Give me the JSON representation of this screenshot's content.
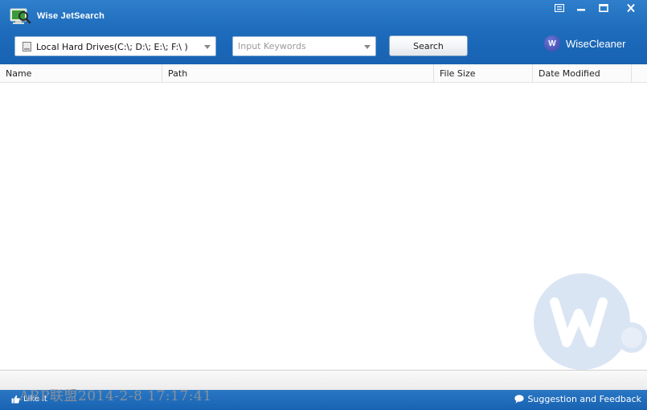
{
  "window": {
    "title": "Wise JetSearch",
    "controls": [
      "menu-icon",
      "minimize-icon",
      "maximize-icon",
      "close-icon"
    ]
  },
  "toolbar": {
    "drive_select": {
      "value": "Local Hard Drives(C:\\; D:\\; E:\\; F:\\ )",
      "icon": "hard-drive-icon"
    },
    "keyword_input": {
      "value": "",
      "placeholder": "Input Keywords"
    },
    "search_label": "Search",
    "brand": {
      "badge": "W",
      "text": "WiseCleaner"
    }
  },
  "results_table": {
    "columns": [
      "Name",
      "Path",
      "File Size",
      "Date Modified"
    ],
    "rows": []
  },
  "footer": {
    "like_label": "Like it",
    "feedback_label": "Suggestion and Feedback"
  },
  "overlay": {
    "watermark_text": "ARP联盟2014-2-8 17:17:41"
  },
  "colors": {
    "header_blue": "#1e6cbc",
    "footer_blue": "#1862b2",
    "border_blue": "#8fb0d4"
  }
}
